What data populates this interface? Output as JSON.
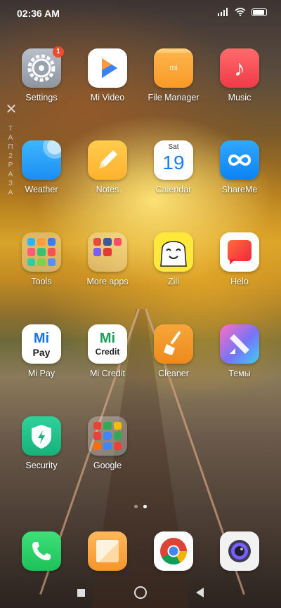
{
  "status_bar": {
    "time": "02:36 AM",
    "icons": [
      "signal-icon",
      "wifi-icon",
      "battery-icon"
    ]
  },
  "side_hint": {
    "close_glyph": "✕",
    "letters": [
      "Т",
      "А",
      "П",
      "2",
      "Р",
      "А",
      "З",
      "А"
    ]
  },
  "apps": {
    "settings": {
      "label": "Settings",
      "badge": "1"
    },
    "mi_video": {
      "label": "Mi Video"
    },
    "file_manager": {
      "label": "File Manager",
      "logo_text": "mi"
    },
    "music": {
      "label": "Music",
      "glyph": "♪"
    },
    "weather": {
      "label": "Weather"
    },
    "notes": {
      "label": "Notes"
    },
    "calendar": {
      "label": "Calendar",
      "day": "Sat",
      "date": "19"
    },
    "shareme": {
      "label": "ShareMe"
    },
    "tools": {
      "label": "Tools"
    },
    "more_apps": {
      "label": "More apps"
    },
    "zili": {
      "label": "Zili"
    },
    "helo": {
      "label": "Helo"
    },
    "mi_pay": {
      "label": "Mi Pay",
      "logo_text": "Mi",
      "sub_text": "Pay"
    },
    "mi_credit": {
      "label": "Mi Credit",
      "logo_text": "Mi",
      "sub_text": "Credit"
    },
    "cleaner": {
      "label": "Cleaner"
    },
    "themes": {
      "label": "Темы"
    },
    "security": {
      "label": "Security"
    },
    "google": {
      "label": "Google"
    }
  },
  "dock": [
    "phone",
    "gallery",
    "chrome",
    "camera"
  ],
  "page_indicator": {
    "pages": 2,
    "active": 2
  },
  "colors": {
    "badge": "#f04a2d",
    "weather": "#1c8ef2",
    "music": "#f03a48",
    "security": "#16b27a",
    "phone": "#1ec05a"
  }
}
